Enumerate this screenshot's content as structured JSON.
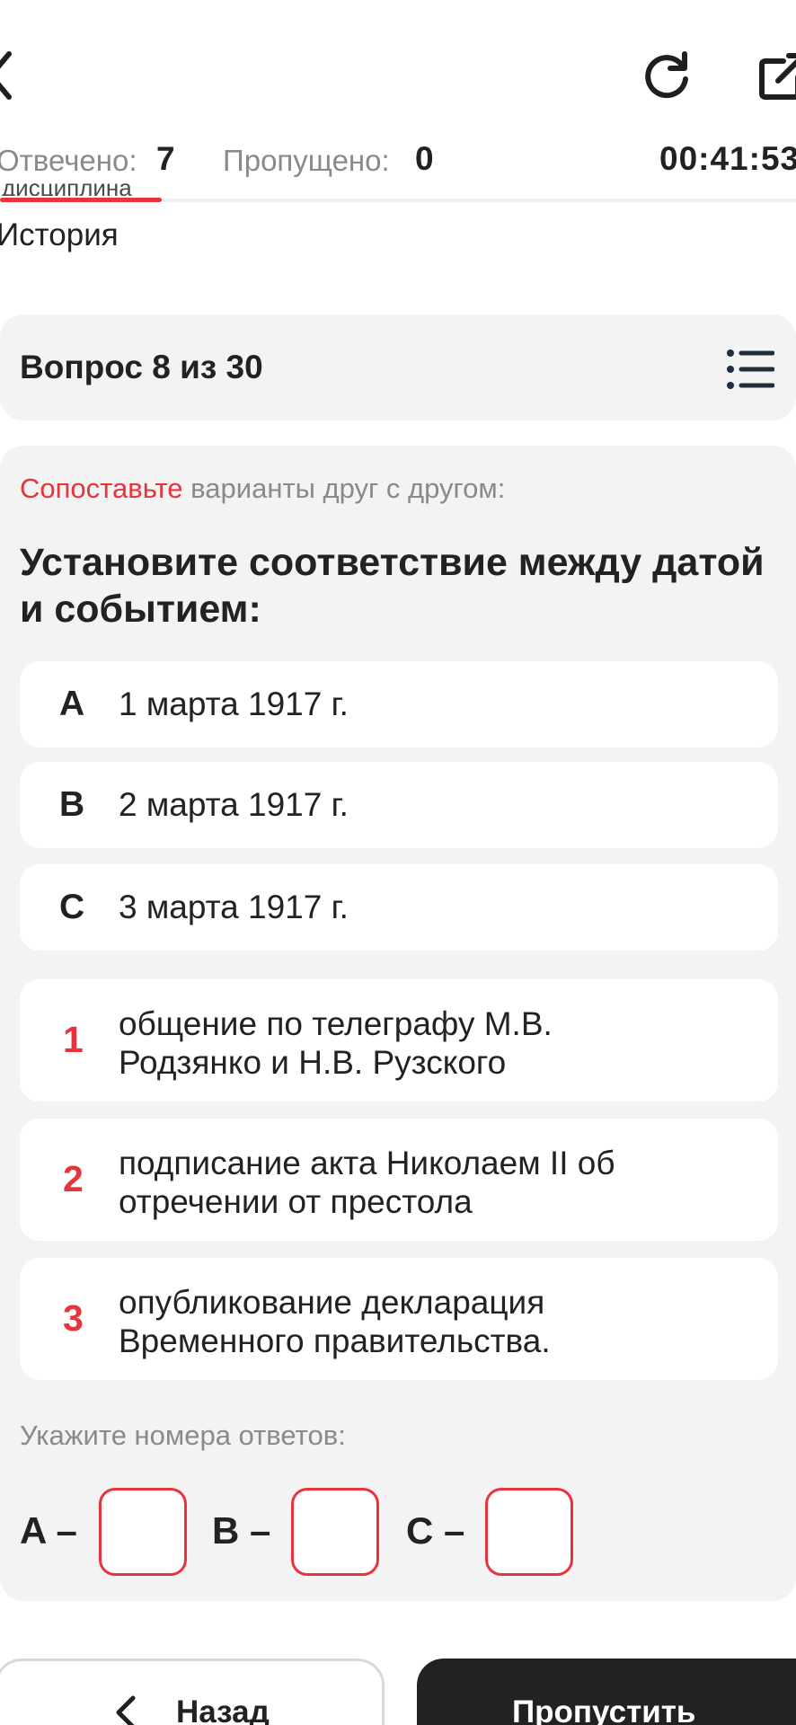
{
  "icons": {
    "back": "chevron-left-icon",
    "reload": "reload-icon",
    "external": "external-link-icon",
    "question_list": "list-icon"
  },
  "stats": {
    "answered_label": "Отвечено:",
    "answered_value": "7",
    "skipped_label": "Пропущено:",
    "skipped_value": "0",
    "timer": "00:41:53",
    "tab_partial_text": "дисциплина"
  },
  "subject": "История",
  "question_header": "Вопрос 8 из 30",
  "instruction": {
    "accent": "Сопоставьте",
    "rest": " варианты друг с другом:"
  },
  "question_text": "Установите соответствие между датой и событием:",
  "dates": [
    {
      "letter": "A",
      "text": "1 марта 1917 г."
    },
    {
      "letter": "B",
      "text": "2 марта 1917 г."
    },
    {
      "letter": "C",
      "text": "3 марта 1917 г."
    }
  ],
  "events": [
    {
      "num": "1",
      "line1": "общение по телеграфу М.В.",
      "line2": "Родзянко и Н.В. Рузского"
    },
    {
      "num": "2",
      "line1": "подписание акта Николаем II об",
      "line2": "отречении от престола"
    },
    {
      "num": "3",
      "line1": "опубликование декларация",
      "line2": "Временного правительства."
    }
  ],
  "answer_prompt": "Укажите номера ответов:",
  "answer_labels": [
    "A –",
    "B –",
    "C –"
  ],
  "answer_values": [
    "",
    "",
    ""
  ],
  "buttons": {
    "back": "Назад",
    "skip": "Пропустить"
  },
  "colors": {
    "accent": "#e8333c",
    "panel": "#f3f3f3",
    "dark_button": "#222222"
  }
}
